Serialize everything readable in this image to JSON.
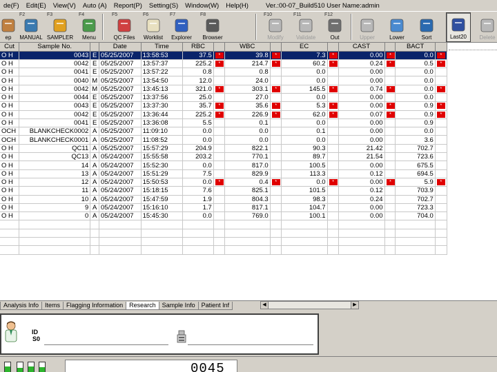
{
  "menu": [
    "de(F)",
    "Edit(E)",
    "View(V)",
    "Auto (A)",
    "Report(P)",
    "Setting(S)",
    "Window(W)",
    "Help(H)"
  ],
  "version_text": "Ver.:00-07_Build510 User Name:admin",
  "toolbar": [
    {
      "key": "",
      "label": "ep",
      "icon": "help-icon",
      "state": "normal"
    },
    {
      "key": "F2",
      "label": "MANUAL",
      "icon": "manual-icon",
      "state": "normal"
    },
    {
      "key": "F3",
      "label": "SAMPLER",
      "icon": "sampler-icon",
      "state": "normal"
    },
    {
      "key": "F4",
      "label": "Menu",
      "icon": "menu-icon",
      "state": "normal"
    },
    {
      "key": "F5",
      "label": "QC Files",
      "icon": "qc-files-icon",
      "state": "normal"
    },
    {
      "key": "F6",
      "label": "Worklist",
      "icon": "worklist-icon",
      "state": "normal"
    },
    {
      "key": "F7",
      "label": "Explorer",
      "icon": "explorer-icon",
      "state": "normal"
    },
    {
      "key": "F8",
      "label": "Browser",
      "icon": "browser-icon",
      "state": "normal"
    },
    {
      "key": "F10",
      "label": "Modify",
      "icon": "modify-icon",
      "state": "disabled"
    },
    {
      "key": "F11",
      "label": "Validate",
      "icon": "validate-icon",
      "state": "disabled"
    },
    {
      "key": "F12",
      "label": "Out",
      "icon": "out-icon",
      "state": "normal"
    },
    {
      "key": "",
      "label": "Upper",
      "icon": "upper-icon",
      "state": "disabled"
    },
    {
      "key": "",
      "label": "Lower",
      "icon": "lower-icon",
      "state": "normal"
    },
    {
      "key": "",
      "label": "Sort",
      "icon": "sort-icon",
      "state": "normal"
    },
    {
      "key": "",
      "label": "Last20",
      "icon": "last20-icon",
      "state": "active"
    },
    {
      "key": "",
      "label": "Delete",
      "icon": "delete-icon",
      "state": "disabled"
    }
  ],
  "columns": [
    "Cut",
    "Sample No.",
    "",
    "Date",
    "Time",
    "RBC",
    "",
    "WBC",
    "",
    "EC",
    "",
    "CAST",
    "",
    "BACT",
    ""
  ],
  "rows": [
    [
      "O H",
      "0043",
      "E",
      "05/25/2007",
      "13:58:53",
      "37.5",
      "*",
      "39.8",
      "*",
      "7.3",
      "*",
      "0.00",
      "*",
      "0.0",
      "*"
    ],
    [
      "O H",
      "0042",
      "E",
      "05/25/2007",
      "13:57:37",
      "225.2",
      "*",
      "214.7",
      "*",
      "60.2",
      "*",
      "0.24",
      "*",
      "0.5",
      "*"
    ],
    [
      "O H",
      "0041",
      "E",
      "05/25/2007",
      "13:57:22",
      "0.8",
      "",
      "0.8",
      "",
      "0.0",
      "",
      "0.00",
      "",
      "0.0",
      ""
    ],
    [
      "O H",
      "0040",
      "M",
      "05/25/2007",
      "13:54:50",
      "12.0",
      "",
      "24.0",
      "",
      "0.0",
      "",
      "0.00",
      "",
      "0.0",
      ""
    ],
    [
      "O H",
      "0042",
      "M",
      "05/25/2007",
      "13:45:13",
      "321.0",
      "*",
      "303.1",
      "*",
      "145.5",
      "*",
      "0.74",
      "*",
      "0.0",
      "*"
    ],
    [
      "O H",
      "0044",
      "E",
      "05/25/2007",
      "13:37:56",
      "25.0",
      "",
      "27.0",
      "",
      "0.0",
      "",
      "0.00",
      "",
      "0.0",
      ""
    ],
    [
      "O H",
      "0043",
      "E",
      "05/25/2007",
      "13:37:30",
      "35.7",
      "*",
      "35.6",
      "*",
      "5.3",
      "*",
      "0.00",
      "*",
      "0.9",
      "*"
    ],
    [
      "O H",
      "0042",
      "E",
      "05/25/2007",
      "13:36:44",
      "225.2",
      "*",
      "226.9",
      "*",
      "62.0",
      "*",
      "0.07",
      "*",
      "0.9",
      "*"
    ],
    [
      "O H",
      "0041",
      "E",
      "05/25/2007",
      "13:36:08",
      "5.5",
      "",
      "0.1",
      "",
      "0.0",
      "",
      "0.00",
      "",
      "0.9",
      ""
    ],
    [
      "OCH",
      "BLANKCHECK0002",
      "A",
      "05/25/2007",
      "11:09:10",
      "0.0",
      "",
      "0.0",
      "",
      "0.1",
      "",
      "0.00",
      "",
      "0.0",
      ""
    ],
    [
      "OCH",
      "BLANKCHECK0001",
      "A",
      "05/25/2007",
      "11:08:52",
      "0.0",
      "",
      "0.0",
      "",
      "0.0",
      "",
      "0.00",
      "",
      "3.6",
      ""
    ],
    [
      "O H",
      "QC11",
      "A",
      "05/25/2007",
      "15:57:29",
      "204.9",
      "",
      "822.1",
      "",
      "90.3",
      "",
      "21.42",
      "",
      "702.7",
      ""
    ],
    [
      "O H",
      "QC13",
      "A",
      "05/24/2007",
      "15:55:58",
      "203.2",
      "",
      "770.1",
      "",
      "89.7",
      "",
      "21.54",
      "",
      "723.6",
      ""
    ],
    [
      "O H",
      "14",
      "A",
      "05/24/2007",
      "15:52:30",
      "0.0",
      "",
      "817.0",
      "",
      "100.5",
      "",
      "0.00",
      "",
      "675.5",
      ""
    ],
    [
      "O H",
      "13",
      "A",
      "05/24/2007",
      "15:51:29",
      "7.5",
      "",
      "829.9",
      "",
      "113.3",
      "",
      "0.12",
      "",
      "694.5",
      ""
    ],
    [
      "O H",
      "12",
      "A",
      "05/24/2007",
      "15:50:53",
      "0.0",
      "*",
      "0.4",
      "*",
      "0.0",
      "*",
      "0.00",
      "*",
      "5.9",
      "*"
    ],
    [
      "O H",
      "11",
      "A",
      "05/24/2007",
      "15:18:15",
      "7.6",
      "",
      "825.1",
      "",
      "101.5",
      "",
      "0.12",
      "",
      "703.9",
      ""
    ],
    [
      "O H",
      "10",
      "A",
      "05/24/2007",
      "15:47:59",
      "1.9",
      "",
      "804.3",
      "",
      "98.3",
      "",
      "0.24",
      "",
      "702.7",
      ""
    ],
    [
      "O H",
      "9",
      "A",
      "05/24/2007",
      "15:16:10",
      "1.7",
      "",
      "817.1",
      "",
      "104.7",
      "",
      "0.00",
      "",
      "723.3",
      ""
    ],
    [
      "O H",
      "0",
      "A",
      "05/24/2007",
      "15:45:30",
      "0.0",
      "",
      "769.0",
      "",
      "100.1",
      "",
      "0.00",
      "",
      "704.0",
      ""
    ]
  ],
  "tabs": [
    "Analysis Info",
    "Items",
    "Flagging Information",
    "Research",
    "Sample Info",
    "Patient Inf"
  ],
  "patient": {
    "id_label": "ID",
    "id_value": "S0"
  },
  "counter": "0045"
}
